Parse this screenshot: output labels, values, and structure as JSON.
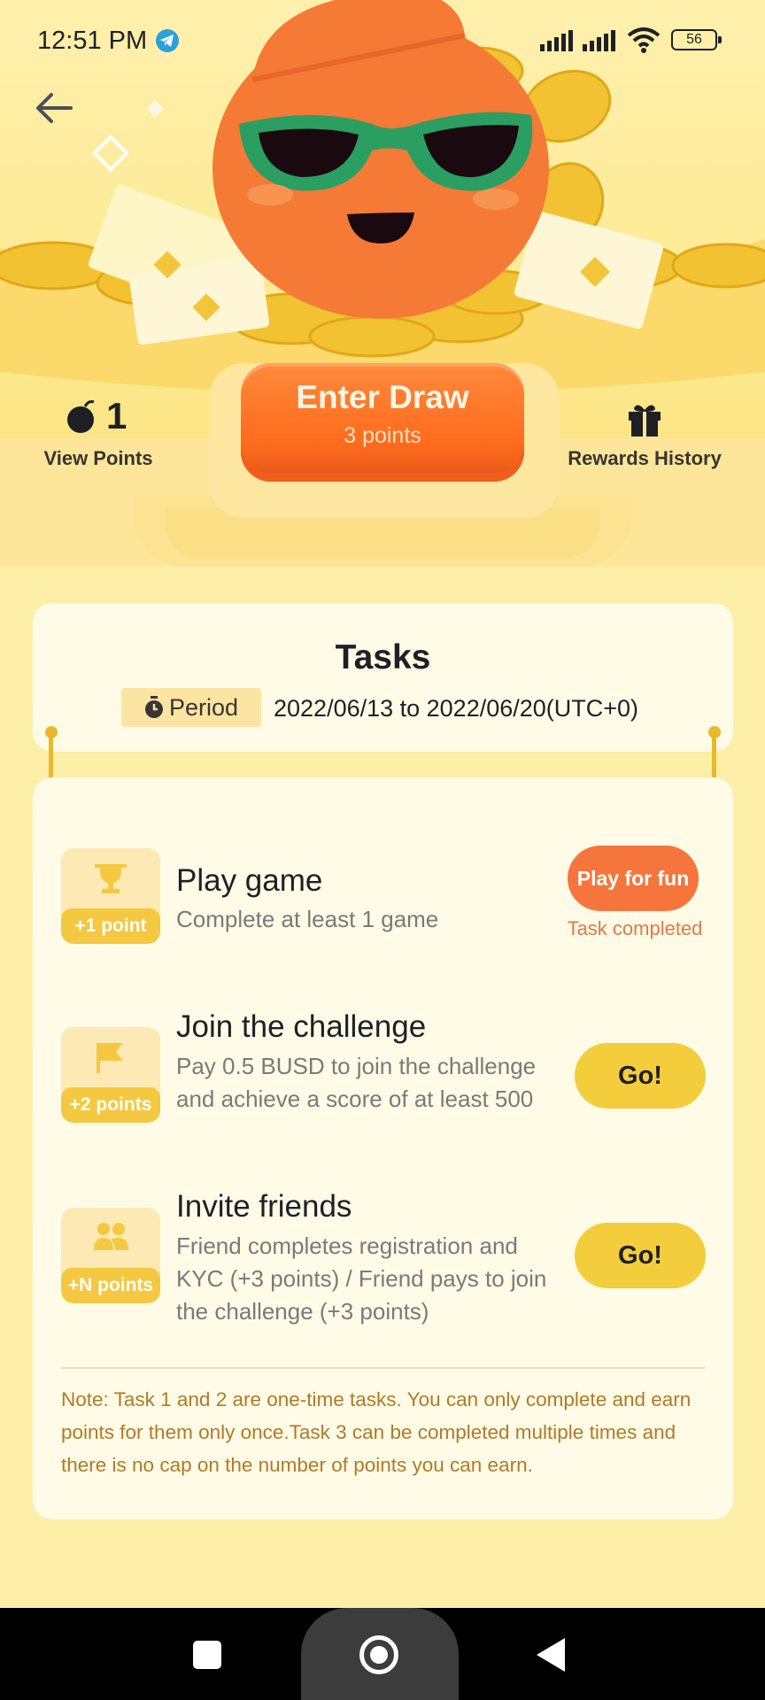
{
  "status_bar": {
    "time": "12:51 PM",
    "battery": "56"
  },
  "hero": {
    "points_value": "1",
    "view_points_label": "View Points",
    "draw_button_title": "Enter Draw",
    "draw_button_cost": "3 points",
    "rewards_history_label": "Rewards History"
  },
  "tasks_header": {
    "title": "Tasks",
    "period_label": "Period",
    "period_range": "2022/06/13 to 2022/06/20(UTC+0)"
  },
  "tasks": [
    {
      "badge": "+1 point",
      "icon": "trophy-icon",
      "title": "Play game",
      "description": "Complete at least 1 game",
      "button": "Play for fun",
      "status": "Task completed"
    },
    {
      "badge": "+2 points",
      "icon": "flag-icon",
      "title": "Join the challenge",
      "description": "Pay 0.5 BUSD to join the challenge and achieve a score of at least 500",
      "button": "Go!"
    },
    {
      "badge": "+N points",
      "icon": "users-icon",
      "title": "Invite friends",
      "description": "Friend completes registration and KYC (+3 points) / Friend pays to join the challenge (+3 points)",
      "button": "Go!"
    }
  ],
  "note": "Note: Task 1 and 2 are one-time tasks. You can only complete and earn points for them only once.Task 3 can be completed multiple times and there is no cap on the number of points you can earn.",
  "colors": {
    "background": "#fdeea8",
    "accent_orange": "#f6753c",
    "accent_yellow": "#f4cd3c",
    "note_text": "#b07a2a"
  }
}
